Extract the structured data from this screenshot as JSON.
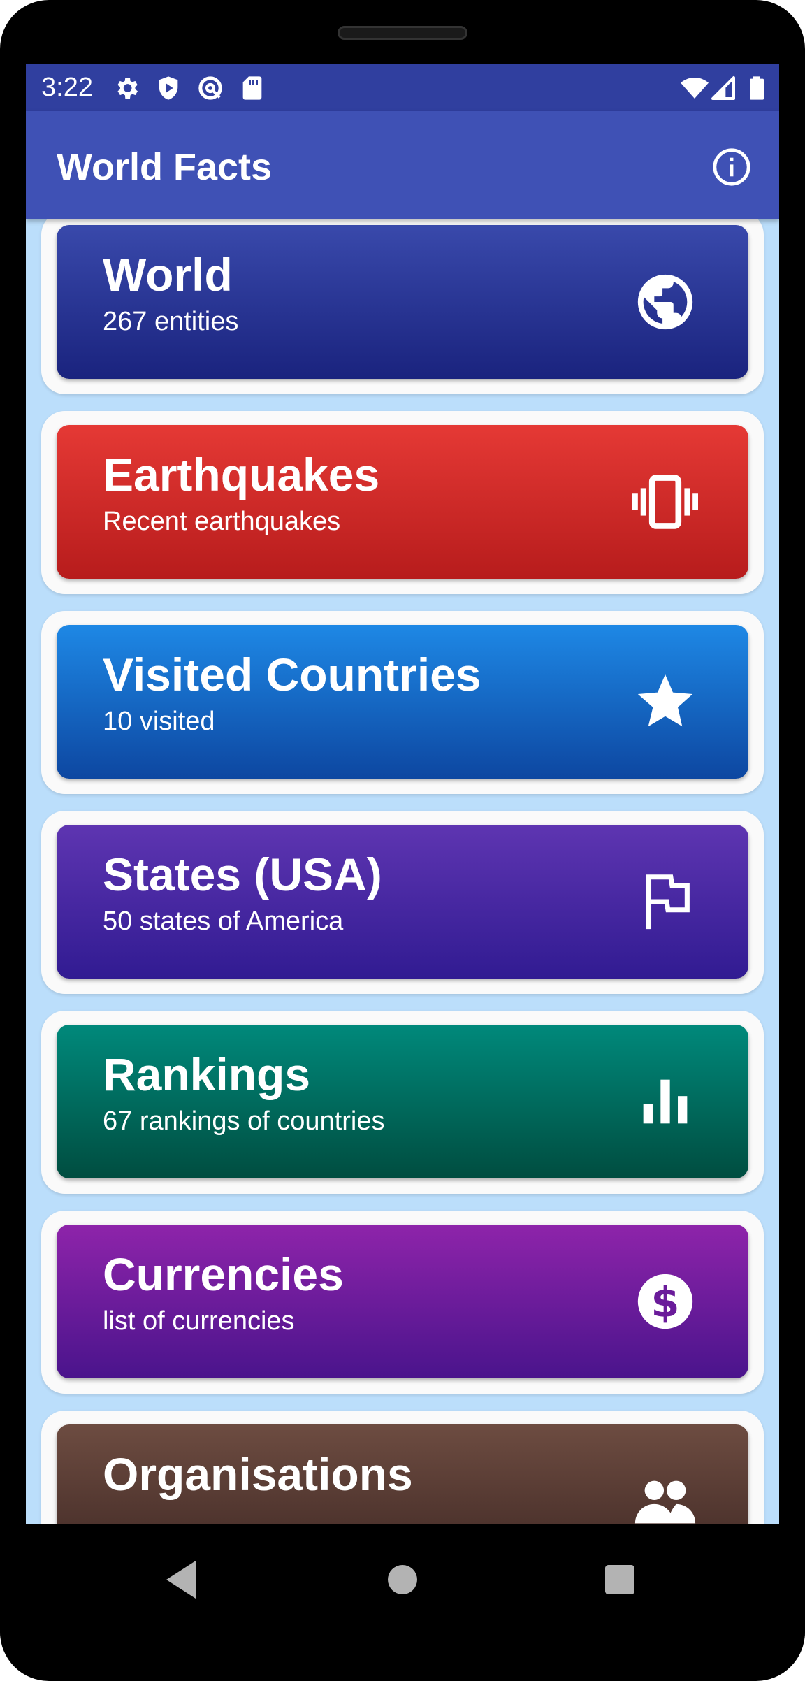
{
  "status_bar": {
    "time": "3:22"
  },
  "app_bar": {
    "title": "World Facts"
  },
  "cards": [
    {
      "title": "World",
      "subtitle": "267 entities",
      "icon": "globe-icon",
      "color_top": "#3949ab",
      "color_bottom": "#1a237e"
    },
    {
      "title": "Earthquakes",
      "subtitle": "Recent earthquakes",
      "icon": "vibration-icon",
      "color_top": "#e53935",
      "color_bottom": "#b71c1c"
    },
    {
      "title": "Visited Countries",
      "subtitle": "10 visited",
      "icon": "star-icon",
      "color_top": "#1e88e5",
      "color_bottom": "#0d47a1"
    },
    {
      "title": "States (USA)",
      "subtitle": "50 states of America",
      "icon": "flag-icon",
      "color_top": "#5e35b1",
      "color_bottom": "#311b92"
    },
    {
      "title": "Rankings",
      "subtitle": "67 rankings of countries",
      "icon": "bar-chart-icon",
      "color_top": "#00897b",
      "color_bottom": "#004d40"
    },
    {
      "title": "Currencies",
      "subtitle": "list of currencies",
      "icon": "dollar-icon",
      "color_top": "#8e24aa",
      "color_bottom": "#4a148c"
    },
    {
      "title": "Organisations",
      "subtitle": "",
      "icon": "groups-icon",
      "color_top": "#6d4c41",
      "color_bottom": "#3e2723"
    }
  ]
}
